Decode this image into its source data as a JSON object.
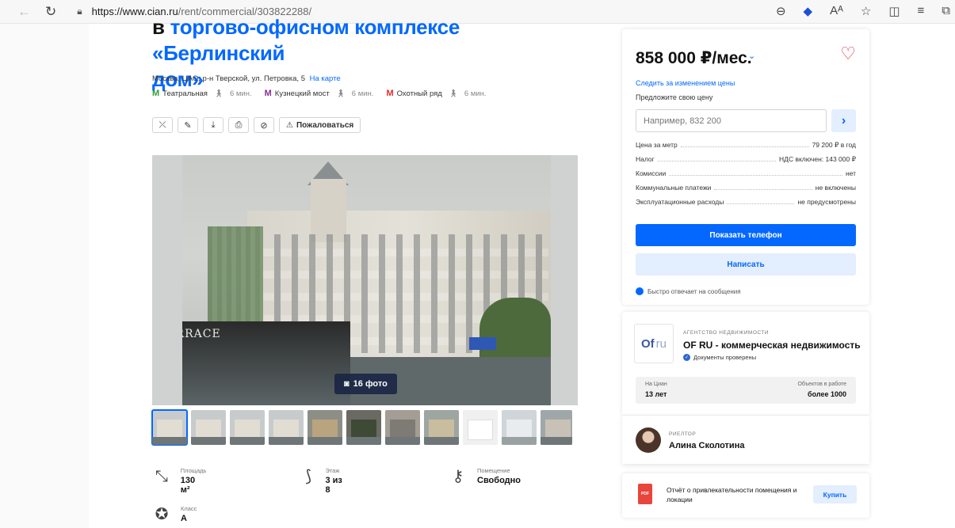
{
  "browser": {
    "url_host": "https://www.cian.ru",
    "url_path": "/rent/commercial/303822288/",
    "back_icon": "arrow-left-icon",
    "reload_icon": "reload-icon"
  },
  "listing": {
    "title_line1_prefix": "в",
    "title_line1": "торгово-офисном комплексе «Берлинский",
    "title_line2": "дом»",
    "address": "Москва, ЦАО, р-н Тверской, ул. Петровка, 5",
    "map_link": "На карте",
    "metro": [
      {
        "name": "Театральная",
        "walk": "6 мин.",
        "color": "#2e9b3a"
      },
      {
        "name": "Кузнецкий мост",
        "walk": "6 мин.",
        "color": "#8a2c8f"
      },
      {
        "name": "Охотный ряд",
        "walk": "6 мин.",
        "color": "#e52b2b"
      }
    ],
    "complain_label": "Пожаловаться",
    "photo_count": "16 фото",
    "photo_caption": "TERRACE"
  },
  "facts": [
    {
      "label": "Площадь",
      "value": "130 м²",
      "icon": "area-icon"
    },
    {
      "label": "Этаж",
      "value": "3 из 8",
      "icon": "stairs-icon"
    },
    {
      "label": "Помещение",
      "value": "Свободно",
      "icon": "key-icon"
    },
    {
      "label": "Класс",
      "value": "A",
      "icon": "star-icon"
    }
  ],
  "price": {
    "value": "858 000 ₽/мес.",
    "follow": "Следить за изменением цены",
    "suggest": "Предложите свою цену",
    "input_placeholder": "Например, 832 200",
    "specs": [
      {
        "k": "Цена за метр",
        "v": "79 200 ₽ в год"
      },
      {
        "k": "Налог",
        "v": "НДС включен: 143 000 ₽"
      },
      {
        "k": "Комиссии",
        "v": "нет"
      },
      {
        "k": "Коммунальные платежи",
        "v": "не включены"
      },
      {
        "k": "Эксплуатационные расходы",
        "v": "не предусмотрены"
      }
    ],
    "show_phone": "Показать телефон",
    "write": "Написать",
    "fast_reply": "Быстро отвечает на сообщения"
  },
  "agency": {
    "logo_a": "Of",
    "logo_b": "ru",
    "tag": "АГЕНТСТВО НЕДВИЖИМОСТИ",
    "name": "OF RU - коммерческая недвижимость",
    "verified": "Документы проверены",
    "on_cian_label": "На Циан",
    "on_cian_value": "13 лет",
    "objects_label": "Объектов в работе",
    "objects_value": "более 1000"
  },
  "realtor": {
    "tag": "РИЕЛТОР",
    "name": "Алина Сколотина"
  },
  "report": {
    "text": "Отчёт о привлекательности помещения и локации",
    "icon_text": "PDF",
    "buy": "Купить"
  },
  "colors": {
    "accent": "#0468ff",
    "heart": "#e8344d"
  }
}
